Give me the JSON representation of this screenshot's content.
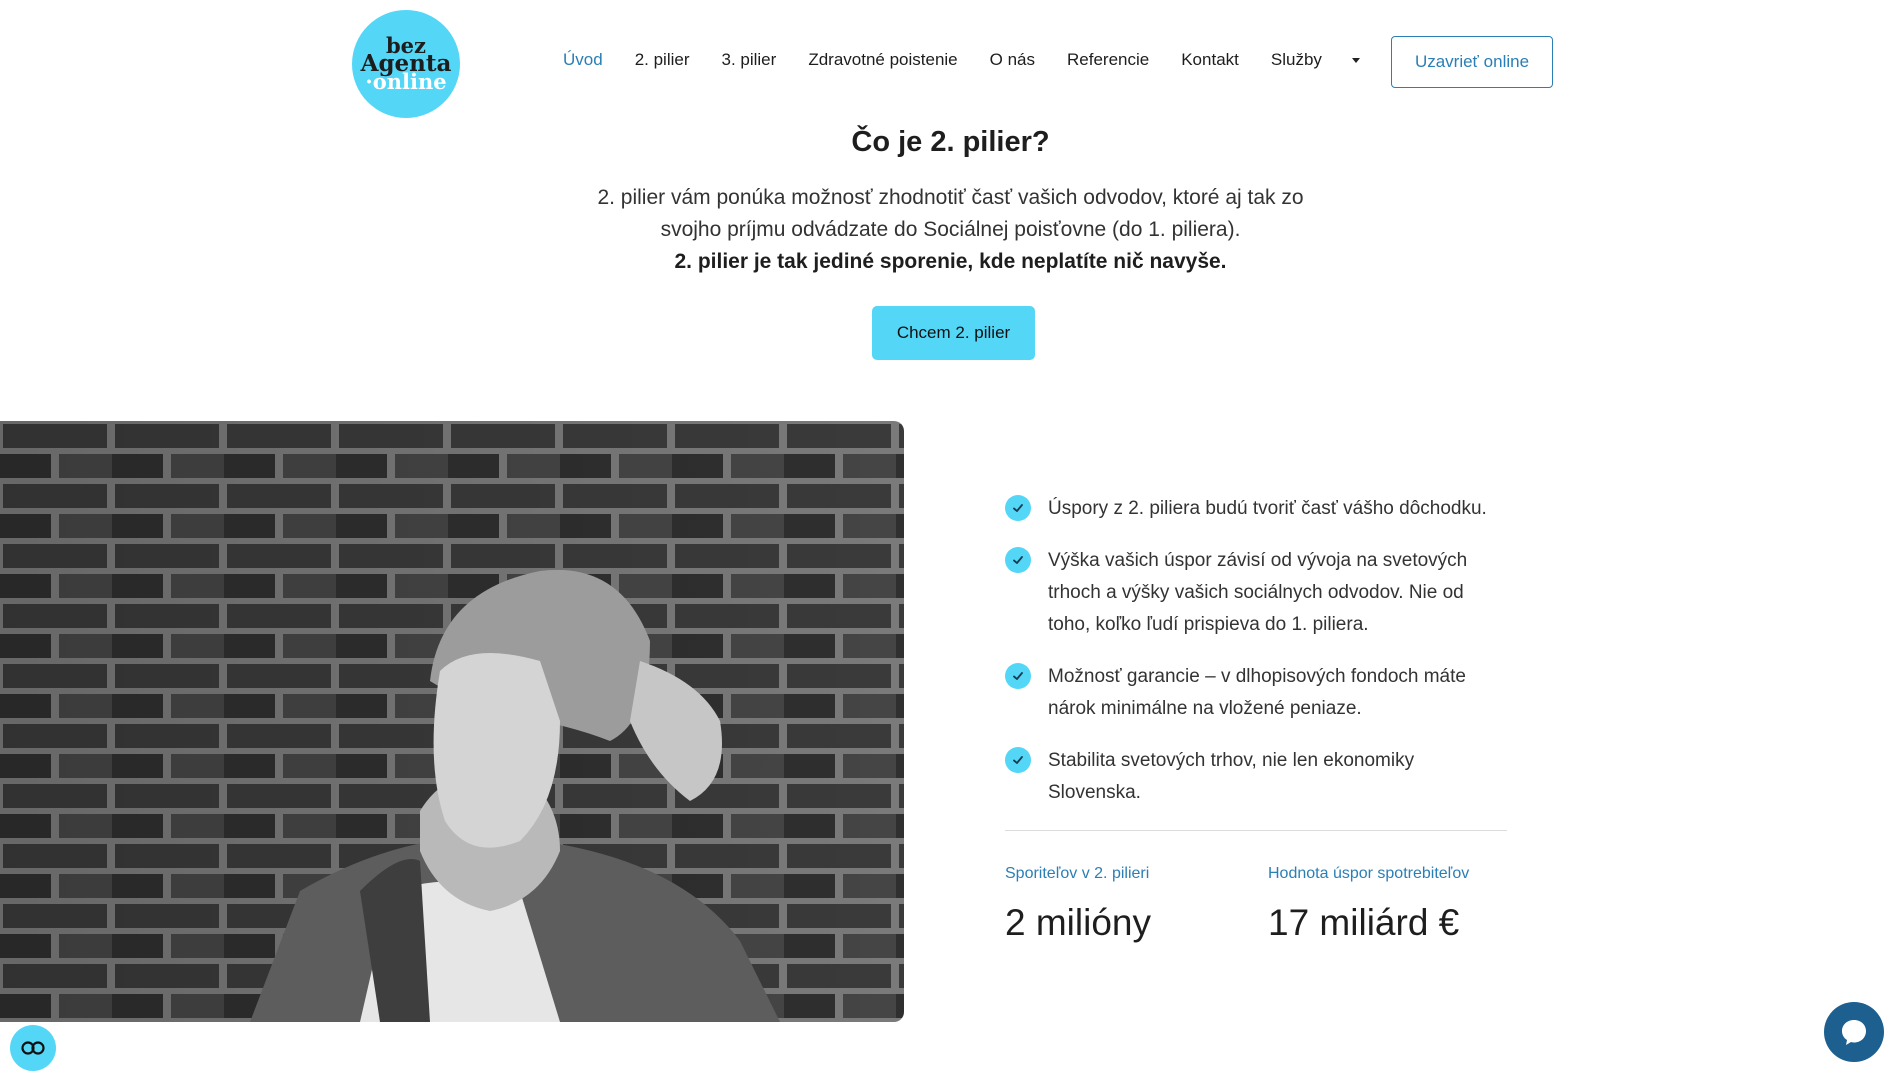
{
  "logo": {
    "line1": "bez",
    "line2": "Agenta",
    "line3": "·online"
  },
  "nav": {
    "items": [
      {
        "label": "Úvod",
        "active": true
      },
      {
        "label": "2. pilier"
      },
      {
        "label": "3. pilier"
      },
      {
        "label": "Zdravotné poistenie"
      },
      {
        "label": "O nás"
      },
      {
        "label": "Referencie"
      },
      {
        "label": "Kontakt"
      },
      {
        "label": "Služby"
      }
    ],
    "cta_label": "Uzavrieť online"
  },
  "hero": {
    "title": "Čo je 2. pilier?",
    "text_line1": "2. pilier vám ponúka možnosť zhodnotiť časť vašich odvodov, ktoré aj tak zo",
    "text_line2": "svojho príjmu odvádzate do Sociálnej poisťovne (do 1. piliera).",
    "text_bold": "2. pilier je tak jediné sporenie, kde neplatíte nič navyše.",
    "button_label": "Chcem 2. pilier"
  },
  "benefits": [
    "Úspory z 2. piliera budú tvoriť časť vášho dôchodku.",
    "Výška vašich úspor závisí od vývoja na svetových trhoch a výšky vašich sociálnych odvodov. Nie od toho, koľko ľudí prispieva do 1. piliera.",
    "Možnosť garancie – v dlhopisových fondoch máte nárok minimálne na vložené peniaze.",
    "Stabilita svetových trhov, nie len ekonomiky Slovenska."
  ],
  "stats": [
    {
      "label": "Sporiteľov v 2. pilieri",
      "value": "2 milióny"
    },
    {
      "label": "Hodnota úspor spotrebiteľov",
      "value": "17 miliárd €"
    }
  ],
  "colors": {
    "accent": "#54d6f7",
    "link": "#2a7fb5",
    "chat": "#1d5f8f"
  }
}
